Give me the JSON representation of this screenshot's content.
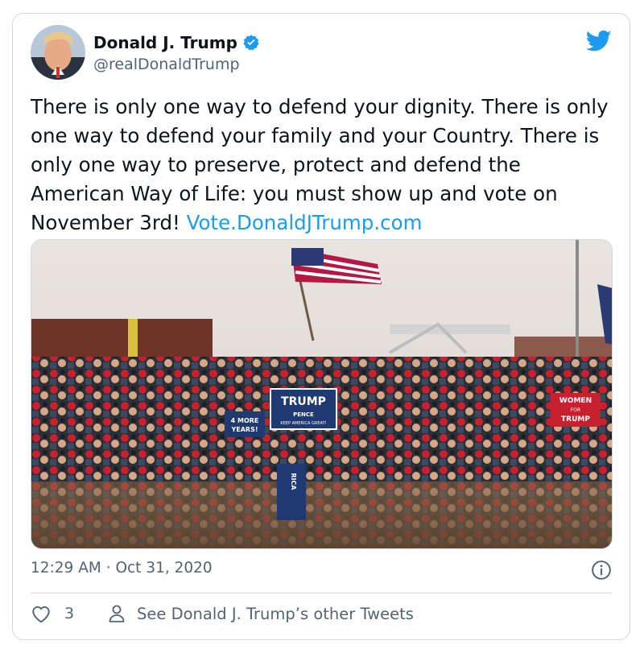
{
  "author": {
    "name": "Donald J. Trump",
    "handle": "@realDonaldTrump"
  },
  "tweet": {
    "text": "There is only one way to defend your dignity. There is only one way to defend your family and your Country. There is only one way to preserve, protect and defend the American Way of Life: you must show up and vote on November 3rd! ",
    "link": "Vote.DonaldJTrump.com"
  },
  "media": {
    "signs": {
      "trump": "TRUMP",
      "pence": "PENCE",
      "slogan": "KEEP AMERICA GREAT!",
      "four_more_line1": "4 MORE",
      "four_more_line2": "YEARS!",
      "women_line1": "WOMEN",
      "women_line2": "FOR",
      "women_line3": "TRUMP",
      "america": "RICA"
    }
  },
  "meta": {
    "timestamp": "12:29 AM · Oct 31, 2020"
  },
  "actions": {
    "like_count": "3",
    "other_tweets_label": "See Donald J. Trump’s other Tweets"
  },
  "icons": {
    "verified": "verified-badge-icon",
    "brand": "twitter-bird-icon",
    "info": "info-icon",
    "like": "heart-icon",
    "profile": "person-icon"
  },
  "colors": {
    "brand_blue": "#1d9bf0",
    "text_primary": "#0f1419",
    "text_secondary": "#536471",
    "border": "#cfd9de"
  }
}
